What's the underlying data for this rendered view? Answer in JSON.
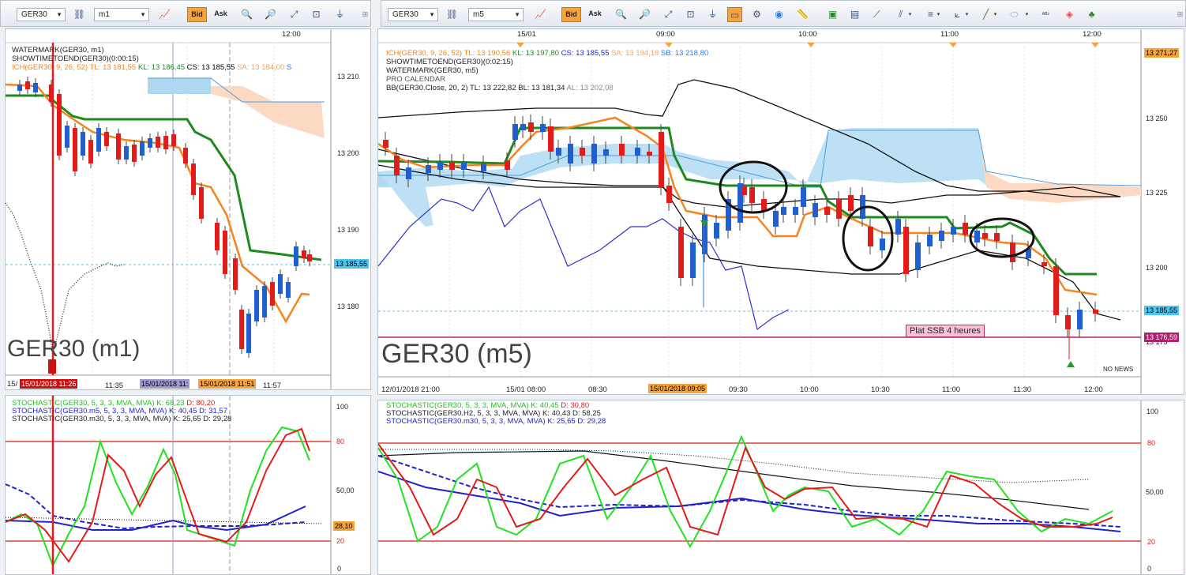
{
  "left_window": {
    "symbol": "GER30",
    "timeframe": "m1",
    "bid_label": "Bid",
    "ask_label": "Ask",
    "top_axis": {
      "time": "12:00"
    },
    "legend": [
      {
        "text": "WATERMARK(GER30, m1)",
        "color": "#000000"
      },
      {
        "text": "SHOWTIMETOEND(GER30)(0:00:15)",
        "color": "#000000"
      }
    ],
    "ichimoku": {
      "name": "ICH(GER30, 9, 26, 52)",
      "tl": "TL: 13 181,55",
      "kl": "KL: 13 186,45",
      "cs": "CS: 13 185,55",
      "sa": "SA: 13 184,00",
      "sb": "S"
    },
    "watermark": "GER30 (m1)",
    "price_labels": [
      "13 210",
      "13 200",
      "13 190",
      "13 180"
    ],
    "current_price": "13 185,55",
    "time_labels": [
      {
        "text": "15/",
        "color": "#222222"
      },
      {
        "text": "15/01/2018 11:26",
        "color": "#cc1111"
      },
      {
        "text": "11:35",
        "color": "#222222"
      },
      {
        "text": "15/01/2018 11:",
        "color": "#6a6ab0"
      },
      {
        "text": "15/01/2018 11:51",
        "color": "#f7a33b"
      },
      {
        "text": "11:57",
        "color": "#222222"
      }
    ],
    "stochastic_legend": [
      {
        "name": "STOCHASTIC(GER30, 5, 3, 3, MVA, MVA)",
        "k": "K: 68,23",
        "d": "D: 80,20",
        "color": "#22c022"
      },
      {
        "name": "STOCHASTIC(GER30.m5, 5, 3, 3, MVA, MVA)",
        "k": "K: 40,45",
        "d": "D: 31,57",
        "color": "#2222cc"
      },
      {
        "name": "STOCHASTIC(GER30.m30, 5, 3, 3, MVA, MVA)",
        "k": "K: 25,65",
        "d": "D: 29,28",
        "color": "#000000"
      }
    ],
    "stoch_labels": [
      "100",
      "80",
      "50,00",
      "28,10",
      "20",
      "0"
    ]
  },
  "right_window": {
    "symbol": "GER30",
    "timeframe": "m5",
    "bid_label": "Bid",
    "ask_label": "Ask",
    "top_axis": [
      "15/01",
      "09:00",
      "10:00",
      "11:00",
      "12:00"
    ],
    "ichimoku": {
      "name": "ICH(GER30, 9, 26, 52)",
      "tl": "TL: 13 190,56",
      "kl": "KL: 13 197,80",
      "cs": "CS: 13 185,55",
      "sa": "SA: 13 194,18",
      "sb": "SB: 13 218,80"
    },
    "legend": [
      {
        "text": "SHOWTIMETOEND(GER30)(0:02:15)",
        "color": "#000000"
      },
      {
        "text": "WATERMARK(GER30, m5)",
        "color": "#000000"
      },
      {
        "text": "PRO CALENDAR",
        "color": "#555555"
      }
    ],
    "bb": {
      "name": "BB(GER30.Close, 20, 2)",
      "tl": "TL: 13 222,82",
      "bl": "BL: 13 181,34",
      "al": "AL: 13 202,08"
    },
    "watermark": "GER30 (m5)",
    "annotation": "Plat SSB 4 heures",
    "no_news": "NO NEWS",
    "price_labels": [
      "13 250",
      "13 225",
      "13 200",
      "13 175"
    ],
    "top_price": "13 271,27",
    "current_price": "13 185,55",
    "ssb_price": "13 176,59",
    "time_labels": [
      "12/01/2018 21:00",
      "15/01 08:00",
      "08:30",
      "09:30",
      "10:00",
      "10:30",
      "11:00",
      "11:30",
      "12:00"
    ],
    "highlight_time": "15/01/2018 09:05",
    "stochastic_legend": [
      {
        "name": "STOCHASTIC(GER30, 5, 3, 3, MVA, MVA)",
        "k": "K: 40,45",
        "d": "D: 30,80",
        "color": "#22c022"
      },
      {
        "name": "STOCHASTIC(GER30.H2, 5, 3, 3, MVA, MVA)",
        "k": "K: 40,43",
        "d": "D: 58,25",
        "color": "#000000"
      },
      {
        "name": "STOCHASTIC(GER30.m30, 5, 3, 3, MVA, MVA)",
        "k": "K: 25,65",
        "d": "D: 29,28",
        "color": "#2222cc"
      }
    ],
    "stoch_labels": [
      "100",
      "80",
      "50,00",
      "20",
      "0"
    ]
  },
  "colors": {
    "bull": "#1f5fcf",
    "bear": "#e21b1b",
    "tenkan": "#f5831f",
    "kijun": "#1e8a1e",
    "cloud": "#aed8f2",
    "cloud_bear": "#fbd9c2",
    "stoch_k": "#22e022",
    "stoch_d": "#e21b1b"
  }
}
